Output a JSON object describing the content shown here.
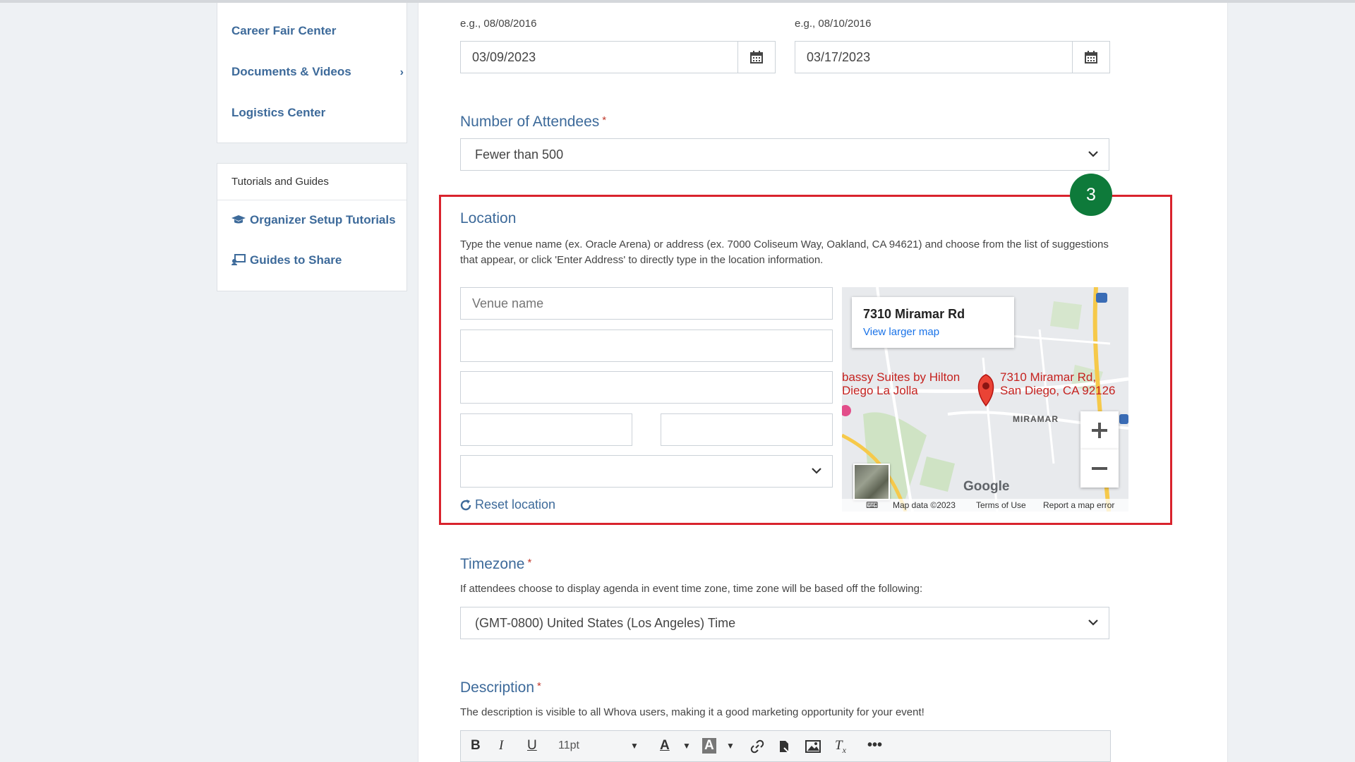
{
  "sidebar": {
    "menu": [
      {
        "label": "Career Fair Center"
      },
      {
        "label": "Documents & Videos"
      },
      {
        "label": "Logistics Center"
      }
    ],
    "guides": {
      "title": "Tutorials and Guides",
      "items": [
        {
          "label": "Organizer Setup Tutorials",
          "icon": "graduation-cap-icon"
        },
        {
          "label": "Guides to Share",
          "icon": "share-guide-icon"
        }
      ]
    }
  },
  "dates": {
    "start_hint": "e.g., 08/08/2016",
    "start_value": "03/09/2023",
    "end_hint": "e.g., 08/10/2016",
    "end_value": "03/17/2023"
  },
  "attendees": {
    "label": "Number of Attendees",
    "required": "*",
    "value": "Fewer than 500"
  },
  "location": {
    "step_badge": "3",
    "label": "Location",
    "help": "Type the venue name (ex. Oracle Arena) or address (ex. 7000 Coliseum Way, Oakland, CA 94621) and choose from the list of suggestions that appear, or click 'Enter Address' to directly type in the location information.",
    "venue_placeholder": "Venue name",
    "reset_label": "Reset location",
    "map": {
      "title": "7310 Miramar Rd",
      "link": "View larger map",
      "pin_line1": "7310 Miramar Rd,",
      "pin_line2": "San Diego, CA 92126",
      "poi_line1": "bassy Suites by Hilton",
      "poi_line2": "Diego La Jolla",
      "area": "MIRAMAR",
      "brand": "Google",
      "footer_data": "Map data ©2023",
      "footer_terms": "Terms of Use",
      "footer_report": "Report a map error",
      "zoom_in": "+",
      "zoom_out": "−"
    }
  },
  "timezone": {
    "label": "Timezone",
    "required": "*",
    "help": "If attendees choose to display agenda in event time zone, time zone will be based off the following:",
    "value": "(GMT-0800) United States (Los Angeles) Time"
  },
  "description": {
    "label": "Description",
    "required": "*",
    "help": "The description is visible to all Whova users, making it a good marketing opportunity for your event!",
    "toolbar": {
      "bold": "B",
      "italic": "I",
      "underline": "U",
      "font_size": "11pt",
      "text_color": "A",
      "bg_color": "A",
      "more": "•••"
    }
  },
  "colors": {
    "accent": "#3d6a9a",
    "highlight": "#d9232d",
    "badge": "#0e7a3a"
  }
}
